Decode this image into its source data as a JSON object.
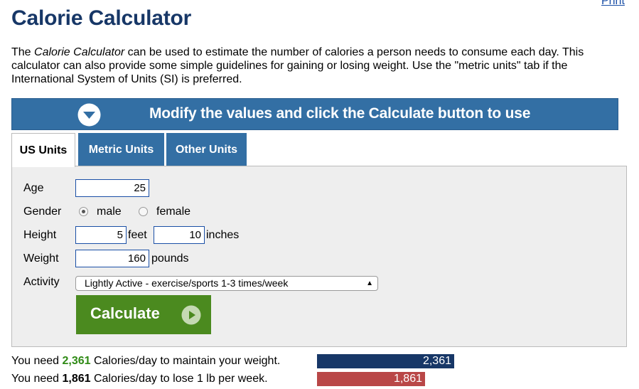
{
  "header": {
    "print_label": "Print",
    "title": "Calorie Calculator"
  },
  "intro": {
    "part1": "The ",
    "italic": "Calorie Calculator",
    "part2": " can be used to estimate the number of calories a person needs to consume each day. This calculator can also provide some simple guidelines for gaining or losing weight. Use the \"metric units\" tab if the International System of Units (SI) is preferred."
  },
  "banner": {
    "icon": "chevron-down-circle-icon",
    "text": "Modify the values and click the Calculate button to use"
  },
  "tabs": [
    {
      "label": "US Units",
      "active": true
    },
    {
      "label": "Metric Units",
      "active": false
    },
    {
      "label": "Other Units",
      "active": false
    }
  ],
  "form": {
    "age_label": "Age",
    "age_value": "25",
    "gender_label": "Gender",
    "gender_options": [
      "male",
      "female"
    ],
    "gender_selected": "male",
    "height_label": "Height",
    "height_feet": "5",
    "feet_unit": "feet",
    "height_inches": "10",
    "inches_unit": "inches",
    "weight_label": "Weight",
    "weight_value": "160",
    "weight_unit": "pounds",
    "activity_label": "Activity",
    "activity_selected": "Lightly Active - exercise/sports 1-3 times/week",
    "calculate_label": "Calculate",
    "calculate_icon": "play-circle-icon"
  },
  "results": [
    {
      "prefix": "You need ",
      "value": "2,361",
      "suffix": " Calories/day to maintain your weight.",
      "bar_label": "2,361",
      "bar_fraction": 1.0,
      "color": "#173767"
    },
    {
      "prefix": "You need ",
      "value": "1,861",
      "suffix": " Calories/day to lose 1 lb per week.",
      "bar_label": "1,861",
      "bar_fraction": 0.788,
      "color": "#b94747"
    }
  ],
  "colors": {
    "title": "#173767",
    "banner": "#336fa4",
    "calculate": "#4b8a1f",
    "highlight_value": "#2f8a15"
  }
}
